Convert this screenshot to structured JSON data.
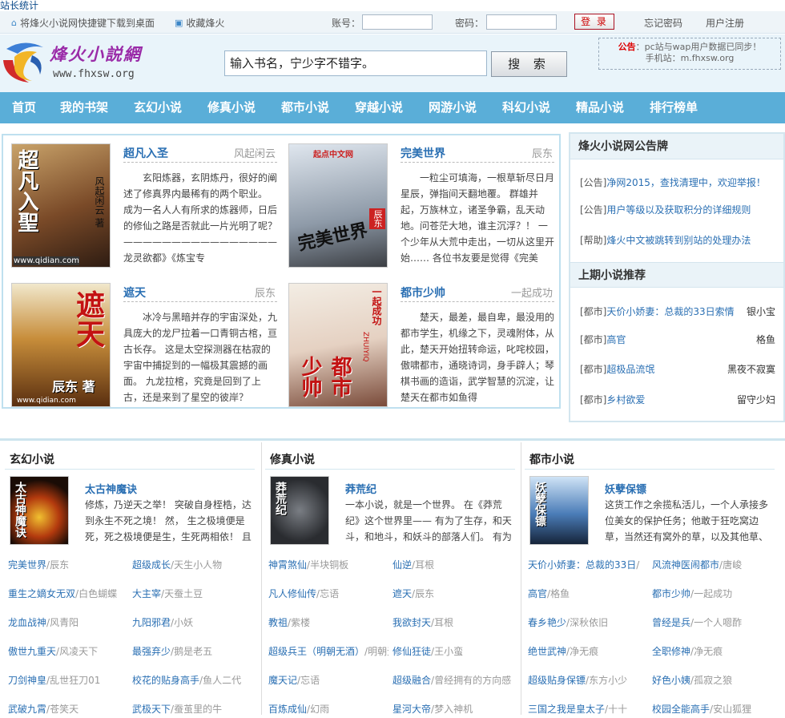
{
  "stat_link": "站长统计",
  "topbar": {
    "shortcut": "将烽火小说网快捷键下载到桌面",
    "bookmark": "收藏烽火",
    "account_label": "账号：",
    "password_label": "密码：",
    "login": "登 录",
    "forgot": "忘记密码",
    "register": "用户注册"
  },
  "header": {
    "logo_title": "烽火小説網",
    "logo_url": "www.fhxsw.org",
    "search_placeholder": "输入书名，宁少字不错字。",
    "search_button": "搜 索",
    "notice_label": "公告",
    "notice_line1": "：pc站与wap用户数据已同步！",
    "notice_line2": "手机站：m.fhxsw.org"
  },
  "nav": [
    "首页",
    "我的书架",
    "玄幻小说",
    "修真小说",
    "都市小说",
    "穿越小说",
    "网游小说",
    "科幻小说",
    "精品小说",
    "排行榜单"
  ],
  "featured": [
    {
      "title": "超凡入圣",
      "author": "风起闲云",
      "desc": "　　玄阳炼器，玄阴炼丹，很好的阐述了修真界内最稀有的两个职业。 成为一名人人有所求的炼器师，日后的修仙之路是否就此一片光明了呢？ ————————————————— 龙灵欲都》《炼宝专",
      "cover_text": "超凡入聖",
      "cover_author": "风起闲云 著",
      "cover_site": "www.qidian.com"
    },
    {
      "title": "完美世界",
      "author": "辰东",
      "desc": "　　一粒尘可填海，一根草斩尽日月星辰，弹指间天翻地覆。 群雄并起，万族林立，诸圣争霸，乱天动地。问苍茫大地，谁主沉浮？！ 一个少年从大荒中走出，一切从这里开始…… 各位书友要是觉得《完美",
      "cover_text": "完美世界",
      "cover_author": "辰东",
      "cover_site": "起点中文网"
    },
    {
      "title": "遮天",
      "author": "辰东",
      "desc": "　　冰冷与黑暗并存的宇宙深处，九具庞大的龙尸拉着一口青铜古棺，亘古长存。 这是太空探测器在枯寂的宇宙中捕捉到的一幅极其震撼的画面。 九龙拉棺，究竟是回到了上古，还是来到了星空的彼岸？",
      "cover_text": "遮天",
      "cover_author": "辰东 著",
      "cover_site": "www.qidian.com"
    },
    {
      "title": "都市少帅",
      "author": "一起成功",
      "desc": "　　楚天，最差，最自卑，最没用的都市学生，机缘之下，灵魂附体，从此，楚天开始扭转命运，叱咤校园，傲啸都市，通晓诗词，身手辟人；琴棋书画的造诣，武学智慧的沉淀，让楚天在都市如鱼得",
      "cover_text": "都市少帅",
      "cover_author": "一起成功",
      "cover_site": "ZHUIYIQ"
    }
  ],
  "sidebar": {
    "board_title": "烽火小说网公告牌",
    "announcements": [
      {
        "tag": "[公告]",
        "text": "净网2015，查找清理中，欢迎举报！"
      },
      {
        "tag": "[公告]",
        "text": "用户等级以及获取积分的详细规则"
      },
      {
        "tag": "[帮助]",
        "text": "烽火中文被跳转到别站的处理办法"
      }
    ],
    "rec_title": "上期小说推荐",
    "recommendations": [
      {
        "tag": "[都市]",
        "title": "天价小娇妻：总裁的33日索情",
        "author": "银小宝"
      },
      {
        "tag": "[都市]",
        "title": "高官",
        "author": "格鱼"
      },
      {
        "tag": "[都市]",
        "title": "超极品流氓",
        "author": "黑夜不寂寞"
      },
      {
        "tag": "[都市]",
        "title": "乡村欲爱",
        "author": "留守少妇"
      }
    ]
  },
  "categories": [
    {
      "name": "玄幻小说",
      "top": {
        "title": "太古神魔诀",
        "desc": "修炼，乃逆天之举！ 突破自身桎梏，达到永生不死之境！ 然， 生之极境便是死，死之极境便是生，生死两相依！ 且",
        "cover_text": "太古神魔诀"
      },
      "items": [
        {
          "t": "完美世界",
          "a": "辰东"
        },
        {
          "t": "超级成长",
          "a": "天生小人物"
        },
        {
          "t": "重生之嫡女无双",
          "a": "白色蝴蝶"
        },
        {
          "t": "大主宰",
          "a": "天蚕土豆"
        },
        {
          "t": "龙血战神",
          "a": "风青阳"
        },
        {
          "t": "九阳邪君",
          "a": "小妖"
        },
        {
          "t": "傲世九重天",
          "a": "风凌天下"
        },
        {
          "t": "最强弃少",
          "a": "鹅是老五"
        },
        {
          "t": "刀剑神皇",
          "a": "乱世狂刀01"
        },
        {
          "t": "校花的贴身高手",
          "a": "鱼人二代"
        },
        {
          "t": "武破九霄",
          "a": "苍笑天"
        },
        {
          "t": "武极天下",
          "a": "蚕茧里的牛"
        }
      ]
    },
    {
      "name": "修真小说",
      "top": {
        "title": "莽荒纪",
        "desc": "一本小说，就是一个世界。 在《莽荒纪》这个世界里—— 有为了生存，和天斗，和地斗，和妖斗的部落人们。 有为",
        "cover_text": "莽荒纪"
      },
      "items": [
        {
          "t": "神霄煞仙",
          "a": "半块铜板"
        },
        {
          "t": "仙逆",
          "a": "耳根"
        },
        {
          "t": "凡人修仙传",
          "a": "忘语"
        },
        {
          "t": "遮天",
          "a": "辰东"
        },
        {
          "t": "教祖",
          "a": "紫楼"
        },
        {
          "t": "我欲封天",
          "a": "耳根"
        },
        {
          "t": "超级兵王（明朝无酒）",
          "a": "明朝无酒"
        },
        {
          "t": "修仙狂徒",
          "a": "王小蛮"
        },
        {
          "t": "魔天记",
          "a": "忘语"
        },
        {
          "t": "超级融合",
          "a": "曾经拥有的方向感"
        },
        {
          "t": "百炼成仙",
          "a": "幻雨"
        },
        {
          "t": "星河大帝",
          "a": "梦入神机"
        }
      ]
    },
    {
      "name": "都市小说",
      "top": {
        "title": "妖孽保镖",
        "desc": "这货工作之余揽私活儿，一个人承接多位美女的保护任务；他敢于狂吃窝边草，当然还有窝外的草，以及其他草、所有",
        "cover_text": "妖孽保镖"
      },
      "items": [
        {
          "t": "天价小娇妻：总裁的33日",
          "a": ""
        },
        {
          "t": "风流神医闹都市",
          "a": "唐峻"
        },
        {
          "t": "高官",
          "a": "格鱼"
        },
        {
          "t": "都市少帅",
          "a": "一起成功"
        },
        {
          "t": "春乡艳少",
          "a": "深秋依旧"
        },
        {
          "t": "曾经是兵",
          "a": "一个人嗯酢"
        },
        {
          "t": "绝世武神",
          "a": "净无痕"
        },
        {
          "t": "全职修神",
          "a": "净无痕"
        },
        {
          "t": "超级贴身保镖",
          "a": "东方小少"
        },
        {
          "t": "好色小姨",
          "a": "孤寂之狼"
        },
        {
          "t": "三国之我是皇太子",
          "a": "十十"
        },
        {
          "t": "校园全能高手",
          "a": "安山狐狸"
        }
      ]
    }
  ]
}
